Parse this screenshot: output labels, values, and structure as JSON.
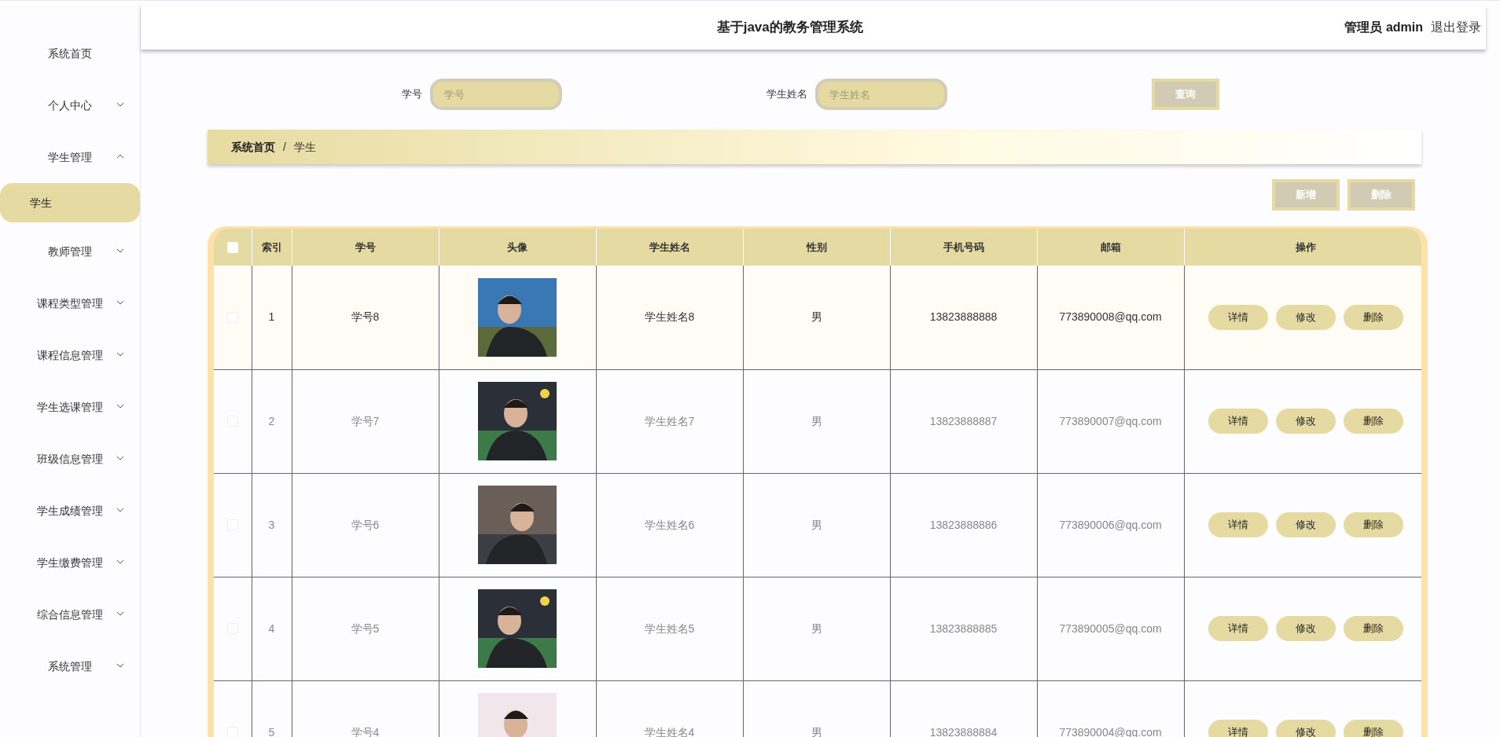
{
  "header": {
    "title": "基于java的教务管理系统",
    "user": "管理员 admin",
    "logout": "退出登录"
  },
  "sidebar": {
    "items": [
      {
        "label": "系统首页",
        "kind": "link"
      },
      {
        "label": "个人中心",
        "kind": "group",
        "expanded": false
      },
      {
        "label": "学生管理",
        "kind": "group",
        "expanded": true,
        "children": [
          {
            "label": "学生",
            "selected": true
          }
        ]
      },
      {
        "label": "教师管理",
        "kind": "group",
        "expanded": false
      },
      {
        "label": "课程类型管理",
        "kind": "group",
        "expanded": false
      },
      {
        "label": "课程信息管理",
        "kind": "group",
        "expanded": false
      },
      {
        "label": "学生选课管理",
        "kind": "group",
        "expanded": false
      },
      {
        "label": "班级信息管理",
        "kind": "group",
        "expanded": false
      },
      {
        "label": "学生成绩管理",
        "kind": "group",
        "expanded": false
      },
      {
        "label": "学生缴费管理",
        "kind": "group",
        "expanded": false
      },
      {
        "label": "综合信息管理",
        "kind": "group",
        "expanded": false
      },
      {
        "label": "系统管理",
        "kind": "group",
        "expanded": false
      }
    ]
  },
  "search": {
    "fields": [
      {
        "label": "学号",
        "placeholder": "学号"
      },
      {
        "label": "学生姓名",
        "placeholder": "学生姓名"
      }
    ],
    "button": "查询"
  },
  "breadcrumb": {
    "items": [
      "系统首页",
      "学生"
    ],
    "separator": "/"
  },
  "actions": [
    "新增",
    "删除"
  ],
  "table": {
    "select_all": {
      "checked": false
    },
    "columns": [
      "索引",
      "学号",
      "头像",
      "学生姓名",
      "性别",
      "手机号码",
      "邮箱",
      "操作"
    ],
    "rows": [
      {
        "checked": false,
        "highlighted": true,
        "index": "1",
        "id": "学号8",
        "name": "学生姓名8",
        "gender": "男",
        "phone": "13823888888",
        "email": "773890008@qq.com",
        "buttons": [
          "详情",
          "修改",
          "删除"
        ]
      },
      {
        "checked": false,
        "highlighted": false,
        "index": "2",
        "id": "学号7",
        "name": "学生姓名7",
        "gender": "男",
        "phone": "13823888887",
        "email": "773890007@qq.com",
        "buttons": [
          "详情",
          "修改",
          "删除"
        ]
      },
      {
        "checked": false,
        "highlighted": false,
        "index": "3",
        "id": "学号6",
        "name": "学生姓名6",
        "gender": "男",
        "phone": "13823888886",
        "email": "773890006@qq.com",
        "buttons": [
          "详情",
          "修改",
          "删除"
        ]
      },
      {
        "checked": false,
        "highlighted": false,
        "index": "4",
        "id": "学号5",
        "name": "学生姓名5",
        "gender": "男",
        "phone": "13823888885",
        "email": "773890005@qq.com",
        "buttons": [
          "详情",
          "修改",
          "删除"
        ]
      },
      {
        "checked": false,
        "highlighted": false,
        "index": "5",
        "id": "学号4",
        "name": "学生姓名4",
        "gender": "男",
        "phone": "13823888884",
        "email": "773890004@qq.com",
        "buttons": [
          "详情",
          "修改",
          "删除"
        ]
      }
    ]
  }
}
